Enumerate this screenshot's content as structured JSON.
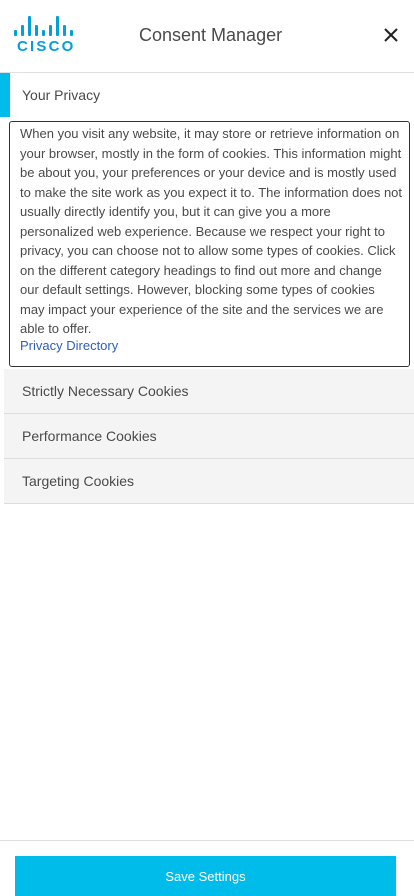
{
  "header": {
    "logo_text": "CISCO",
    "title": "Consent Manager",
    "close_icon": "close-icon"
  },
  "menu": {
    "active_tab": "Your Privacy",
    "description": "When you visit any website, it may store or retrieve information on your browser, mostly in the form of cookies. This information might be about you, your preferences or your device and is mostly used to make the site work as you expect it to. The information does not usually directly identify you, but it can give you a more personalized web experience. Because we respect your right to privacy, you can choose not to allow some types of cookies. Click on the different category headings to find out more and change our default settings. However, blocking some types of cookies may impact your experience of the site and the services we are able to offer.",
    "privacy_link": "Privacy Directory",
    "categories": [
      "Strictly Necessary Cookies",
      "Performance Cookies",
      "Targeting Cookies"
    ]
  },
  "footer": {
    "save_label": "Save Settings"
  },
  "colors": {
    "accent": "#00bceb",
    "brand": "#049fd9",
    "link": "#2c5fb8"
  }
}
